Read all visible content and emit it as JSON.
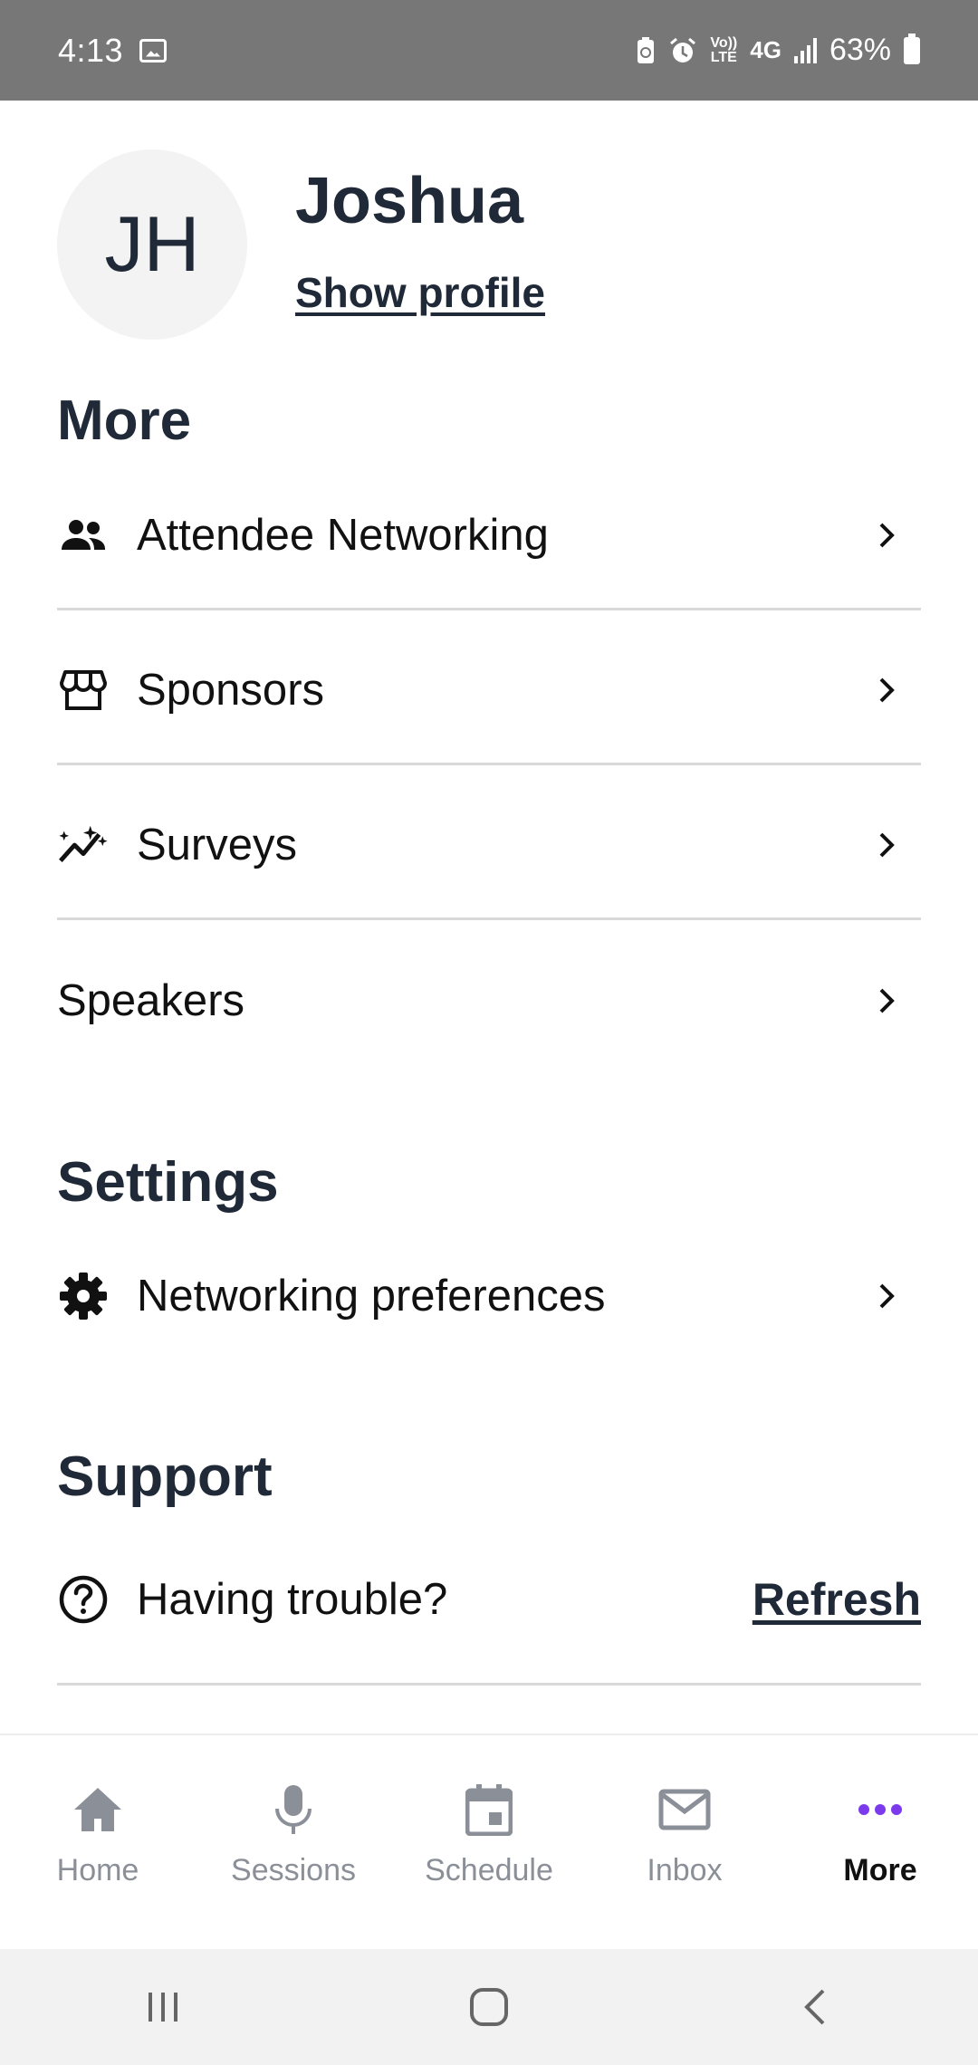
{
  "status_bar": {
    "time": "4:13",
    "network_top": "Vo))",
    "network_bottom": "LTE",
    "network_type": "4G",
    "battery": "63%"
  },
  "profile": {
    "initials": "JH",
    "name": "Joshua",
    "show_profile_label": "Show profile"
  },
  "sections": {
    "more_title": "More",
    "settings_title": "Settings",
    "support_title": "Support"
  },
  "more_items": [
    {
      "label": "Attendee Networking",
      "icon": "people-icon"
    },
    {
      "label": "Sponsors",
      "icon": "storefront-icon"
    },
    {
      "label": "Surveys",
      "icon": "sparkle-chart-icon"
    },
    {
      "label": "Speakers",
      "icon": ""
    }
  ],
  "settings_items": [
    {
      "label": "Networking preferences",
      "icon": "gear-icon"
    }
  ],
  "support": {
    "label": "Having trouble?",
    "action_label": "Refresh",
    "icon": "help-circle-icon"
  },
  "tabs": [
    {
      "label": "Home",
      "icon": "home-icon"
    },
    {
      "label": "Sessions",
      "icon": "microphone-icon"
    },
    {
      "label": "Schedule",
      "icon": "calendar-icon"
    },
    {
      "label": "Inbox",
      "icon": "mail-icon"
    },
    {
      "label": "More",
      "icon": "more-dots-icon",
      "active": true
    }
  ],
  "colors": {
    "text": "#1f2937",
    "accent": "#7c3aed",
    "tab_inactive": "#8a8f98",
    "status_bar": "#777777"
  }
}
